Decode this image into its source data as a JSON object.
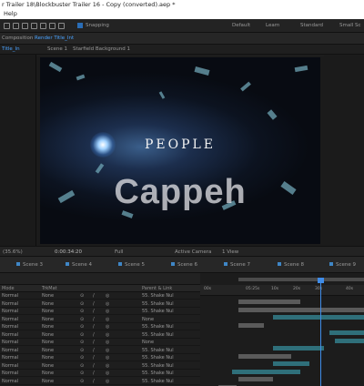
{
  "window": {
    "title": "r Trailer 18\\Blockbuster Trailer 16 - Copy (converted).aep *",
    "menu": [
      "Help"
    ]
  },
  "toolbar": {
    "snapping_label": "Snapping",
    "workspaces": [
      "Default",
      "Learn",
      "Standard",
      "Small Sc"
    ]
  },
  "comp_panel": {
    "tabs": [
      "Composition",
      "Render Title_Int"
    ],
    "breadcrumb": [
      "Title_In",
      "Scene 1",
      "Starfield Background 1"
    ]
  },
  "viewer": {
    "frame_text": "PEOPLE",
    "watermark": "Cappeh"
  },
  "viewer_controls": {
    "zoom": "(35.6%)",
    "timecode": "0:00:34:20",
    "resolution": "Full",
    "camera": "Active Camera",
    "views": "1 View"
  },
  "timeline_tabs": [
    "Scene 3",
    "Scene 4",
    "Scene 5",
    "Scene 6",
    "Scene 7",
    "Scene 8",
    "Scene 9"
  ],
  "layer_columns": [
    "Mode",
    "T",
    "TrkMat",
    "Parent & Link"
  ],
  "layers": [
    {
      "mode": "Normal",
      "trkmat": "None",
      "parent": "55. Shake Nul"
    },
    {
      "mode": "Normal",
      "trkmat": "None",
      "parent": "55. Shake Nul"
    },
    {
      "mode": "Normal",
      "trkmat": "None",
      "parent": "55. Shake Nul"
    },
    {
      "mode": "Normal",
      "trkmat": "None",
      "parent": "None"
    },
    {
      "mode": "Normal",
      "trkmat": "None",
      "parent": "55. Shake Nul"
    },
    {
      "mode": "Normal",
      "trkmat": "None",
      "parent": "55. Shake Nul"
    },
    {
      "mode": "Normal",
      "trkmat": "None",
      "parent": "None"
    },
    {
      "mode": "Normal",
      "trkmat": "None",
      "parent": "55. Shake Nul"
    },
    {
      "mode": "Normal",
      "trkmat": "None",
      "parent": "55. Shake Nul"
    },
    {
      "mode": "Normal",
      "trkmat": "None",
      "parent": "55. Shake Nul"
    },
    {
      "mode": "Normal",
      "trkmat": "None",
      "parent": "55. Shake Nul"
    },
    {
      "mode": "Normal",
      "trkmat": "None",
      "parent": "55. Shake Nul"
    }
  ],
  "ruler_ticks": [
    "00s",
    "05:25s",
    "10s",
    "20s",
    "30s",
    "40s"
  ],
  "colors": {
    "accent": "#3f8ce8",
    "bar_teal": "#2f6f7a",
    "bar_gray": "#5a5a5a"
  }
}
